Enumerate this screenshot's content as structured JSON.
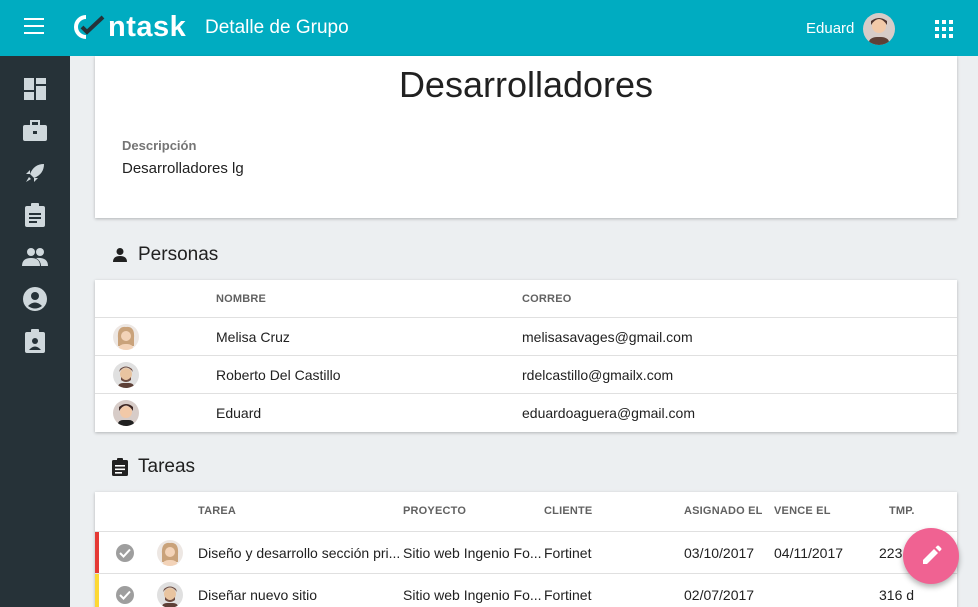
{
  "header": {
    "logo_text": "ntask",
    "title": "Detalle de Grupo",
    "user_name": "Eduard"
  },
  "sidebar": {
    "items": [
      {
        "icon": "dashboard-icon"
      },
      {
        "icon": "briefcase-icon"
      },
      {
        "icon": "rocket-icon"
      },
      {
        "icon": "clipboard-icon"
      },
      {
        "icon": "people-icon"
      },
      {
        "icon": "account-circle-icon"
      },
      {
        "icon": "badge-icon"
      }
    ]
  },
  "group": {
    "name": "Desarrolladores",
    "description_label": "Descripción",
    "description": "Desarrolladores lg"
  },
  "people": {
    "title": "Personas",
    "columns": [
      "NOMBRE",
      "CORREO"
    ],
    "rows": [
      {
        "name": "Melisa Cruz",
        "email": "melisasavages@gmail.com"
      },
      {
        "name": "Roberto Del Castillo",
        "email": "rdelcastillo@gmailx.com"
      },
      {
        "name": "Eduard",
        "email": "eduardoaguera@gmail.com"
      }
    ]
  },
  "tasks": {
    "title": "Tareas",
    "columns": [
      "TAREA",
      "PROYECTO",
      "CLIENTE",
      "ASIGNADO EL",
      "VENCE EL",
      "TMP."
    ],
    "rows": [
      {
        "task": "Diseño y desarrollo sección pri...",
        "project": "Sitio web Ingenio Fo...",
        "client": "Fortinet",
        "assigned": "03/10/2017",
        "due": "04/11/2017",
        "time": "223",
        "status_color": "#e53935"
      },
      {
        "task": "Diseñar nuevo sitio",
        "project": "Sitio web Ingenio Fo...",
        "client": "Fortinet",
        "assigned": "02/07/2017",
        "due": "",
        "time": "316 d",
        "status_color": "#fdd835"
      }
    ]
  },
  "colors": {
    "topbar": "#00acc1",
    "sidebar": "#263238",
    "fab": "#f06292"
  }
}
